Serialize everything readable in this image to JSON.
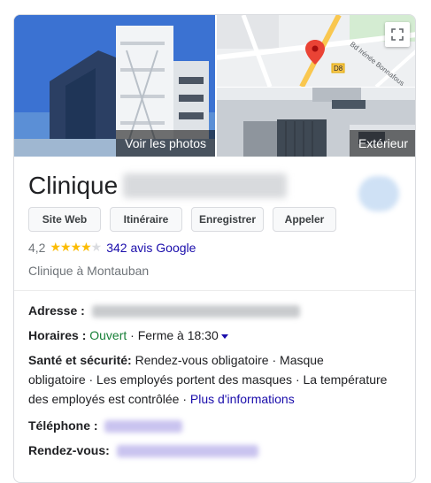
{
  "photos": {
    "main_overlay": "Voir les photos",
    "ext_overlay": "Extérieur",
    "map": {
      "road_label": "Bd Irénée Bonnafous",
      "route_badge": "D8"
    }
  },
  "business": {
    "name": "Clinique",
    "rating": "4,2",
    "rating_stars": 4,
    "reviews": "342 avis Google",
    "category": "Clinique à Montauban"
  },
  "actions": [
    "Site Web",
    "Itinéraire",
    "Enregistrer",
    "Appeler"
  ],
  "details": {
    "address_label": "Adresse :",
    "hours_label": "Horaires :",
    "hours_status": "Ouvert",
    "hours_close": " · Ferme à 18:30",
    "health_label": "Santé et sécurité:",
    "health_line1": " Rendez-vous obligatoire · Masque",
    "health_line2": "obligatoire · Les employés portent des masques · La température",
    "health_line3": "des employés est contrôlée · ",
    "more_info": "Plus d'informations",
    "phone_label": "Téléphone :",
    "appointment_label": "Rendez-vous:"
  },
  "colors": {
    "link": "#1a0dab",
    "open_green": "#188038",
    "star": "#fbbc04",
    "map_road": "#f9c74f",
    "map_pin": "#ea4335"
  }
}
